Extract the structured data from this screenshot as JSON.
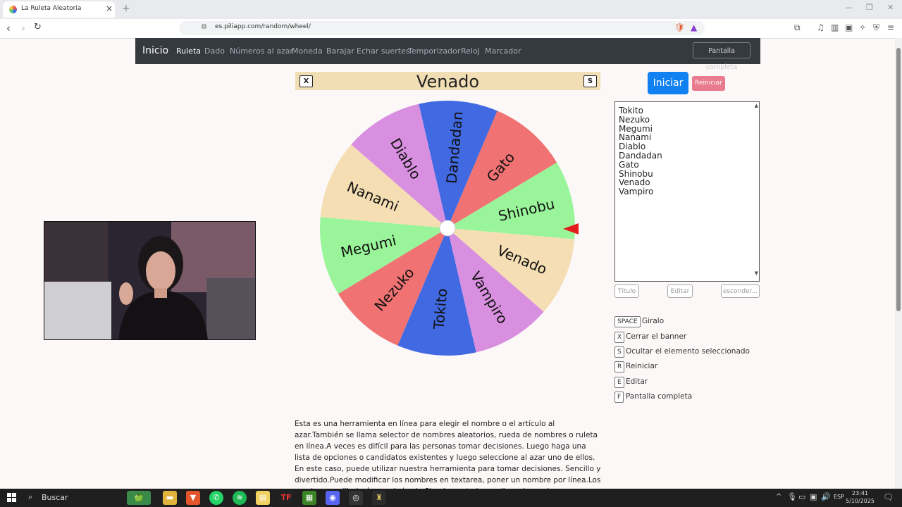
{
  "browser": {
    "tab_title": "La Ruleta Aleatoria",
    "url": "es.piliapp.com/random/wheel/"
  },
  "nav": {
    "brand": "Inicio",
    "links": [
      "Ruleta",
      "Dado",
      "Números al azar",
      "Moneda",
      "Barajar",
      "Echar suertes",
      "Temporizador",
      "Reloj",
      "Marcador"
    ],
    "fullscreen": "Pantalla completa"
  },
  "banner": {
    "close_key": "X",
    "winner": "Venado",
    "hide_key": "S"
  },
  "wheel": {
    "segments": [
      {
        "name": "Tokito",
        "color": "#4169e1"
      },
      {
        "name": "Nezuko",
        "color": "#f07272"
      },
      {
        "name": "Megumi",
        "color": "#9af59a"
      },
      {
        "name": "Nanami",
        "color": "#f5deb3"
      },
      {
        "name": "Diablo",
        "color": "#d98fdf"
      },
      {
        "name": "Dandadan",
        "color": "#4169e1"
      },
      {
        "name": "Gato",
        "color": "#f07272"
      },
      {
        "name": "Shinobu",
        "color": "#9af59a"
      },
      {
        "name": "Venado",
        "color": "#f5deb3"
      },
      {
        "name": "Vampiro",
        "color": "#d98fdf"
      }
    ]
  },
  "controls": {
    "start": "Iniciar",
    "reset": "Reiniciar",
    "names_text": "Tokito\nNezuko\nMegumi\nNanami\nDiablo\nDandadan\nGato\nShinobu\nVenado\nVampiro",
    "title_btn": "Título",
    "edit_btn": "Editar",
    "hide_btn": "esconder..."
  },
  "shortcuts": [
    {
      "key": "SPACE",
      "label": "Giralo"
    },
    {
      "key": "X",
      "label": "Cerrar el banner"
    },
    {
      "key": "S",
      "label": "Ocultar el elemento seleccionado"
    },
    {
      "key": "R",
      "label": "Reiniciar"
    },
    {
      "key": "E",
      "label": "Editar"
    },
    {
      "key": "F",
      "label": "Pantalla completa"
    }
  ],
  "description": "Esta es una herramienta en línea para elegir el nombre o el artículo al azar.También se llama selector de nombres aleatorios, rueda de nombres o ruleta en línea.A veces es difícil para las personas tomar decisiones. Luego haga una lista de opciones o candidatos existentes y luego seleccione al azar uno de ellos. En este caso, puede utilizar nuestra herramienta para tomar decisiones. Sencillo y divertido.Puede modificar los nombres en textarea, poner un nombre por línea.Los nombres se dibujarán en el círculo.Simplemente haga clic en la rueda",
  "taskbar": {
    "search": "Buscar",
    "time": "23:41",
    "date": "5/10/2025",
    "lang": "ESP"
  },
  "colors": {
    "nav_bg": "#343a40",
    "banner_bg": "#f2deb5",
    "primary": "#1180f0",
    "reset": "#e87c8e",
    "pointer": "#e31b1b"
  }
}
